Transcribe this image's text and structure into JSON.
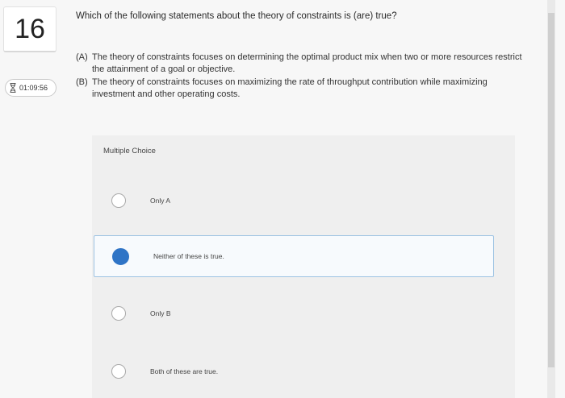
{
  "question": {
    "number": "16",
    "timer": "01:09:56",
    "prompt": "Which of the following statements about the theory of constraints is (are) true?",
    "statements": [
      {
        "tag": "(A)",
        "text": "The theory of constraints focuses on determining the optimal product mix when two or more resources restrict the attainment of a goal or objective."
      },
      {
        "tag": "(B)",
        "text": "The theory of constraints focuses on maximizing the rate of throughput contribution while maximizing investment and other operating costs."
      }
    ]
  },
  "multiple_choice": {
    "label": "Multiple Choice",
    "options": [
      {
        "text": "Only A",
        "selected": false
      },
      {
        "text": "Neither of these is true.",
        "selected": true
      },
      {
        "text": "Only B",
        "selected": false
      },
      {
        "text": "Both of these are true.",
        "selected": false
      }
    ]
  },
  "colors": {
    "accent": "#2f74c6",
    "panel": "#efefef"
  },
  "icons": {
    "timer": "hourglass-icon"
  }
}
